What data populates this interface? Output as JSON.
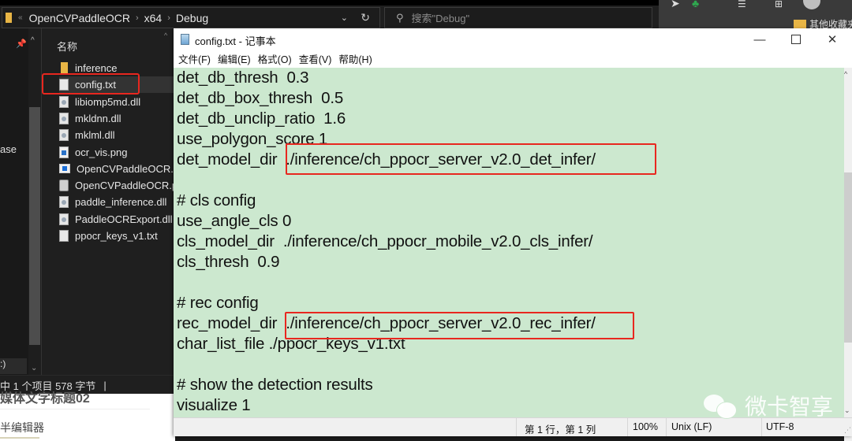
{
  "explorer": {
    "breadcrumb": [
      "OpenCVPaddleOCR",
      "x64",
      "Debug"
    ],
    "search_placeholder": "搜索\"Debug\"",
    "nav_items": {
      "partial_base": "ase",
      "drive_c": ":)",
      "drive_d": "\\"
    },
    "column_header": "名称",
    "files": [
      {
        "name": "inference",
        "type": "folder"
      },
      {
        "name": "config.txt",
        "type": "txt",
        "selected": true
      },
      {
        "name": "libiomp5md.dll",
        "type": "dll"
      },
      {
        "name": "mkldnn.dll",
        "type": "dll"
      },
      {
        "name": "mklml.dll",
        "type": "dll"
      },
      {
        "name": "ocr_vis.png",
        "type": "png"
      },
      {
        "name": "OpenCVPaddleOCR.exe",
        "type": "exe"
      },
      {
        "name": "OpenCVPaddleOCR.pdb",
        "type": "pdb"
      },
      {
        "name": "paddle_inference.dll",
        "type": "dll"
      },
      {
        "name": "PaddleOCRExport.dll",
        "type": "dll"
      },
      {
        "name": "ppocr_keys_v1.txt",
        "type": "txt"
      }
    ],
    "status": "中 1 个项目  578 字节",
    "status_sep": "|"
  },
  "browser": {
    "bookmark_folder": "其他收藏夹"
  },
  "article": {
    "title_fragment": "媒体文字标题02",
    "editor_label": "半编辑器"
  },
  "notepad": {
    "title": "config.txt - 记事本",
    "menu": [
      "文件(F)",
      "编辑(E)",
      "格式(O)",
      "查看(V)",
      "帮助(H)"
    ],
    "window_buttons": {
      "minimize": "—",
      "close": "✕"
    },
    "lines": [
      "det_db_thresh  0.3",
      "det_db_box_thresh  0.5",
      "det_db_unclip_ratio  1.6",
      "use_polygon_score 1",
      "det_model_dir  ./inference/ch_ppocr_server_v2.0_det_infer/",
      "",
      "# cls config",
      "use_angle_cls 0",
      "cls_model_dir  ./inference/ch_ppocr_mobile_v2.0_cls_infer/",
      "cls_thresh  0.9",
      "",
      "# rec config",
      "rec_model_dir  ./inference/ch_ppocr_server_v2.0_rec_infer/",
      "char_list_file ./ppocr_keys_v1.txt",
      "",
      "# show the detection results",
      "visualize 1"
    ],
    "status": {
      "position": "第 1 行，第 1 列",
      "zoom": "100%",
      "line_ending": "Unix (LF)",
      "encoding": "UTF-8"
    },
    "highlight_color": "#e8271f",
    "editor_bg": "#cce8cf"
  },
  "watermark": "微卡智享"
}
